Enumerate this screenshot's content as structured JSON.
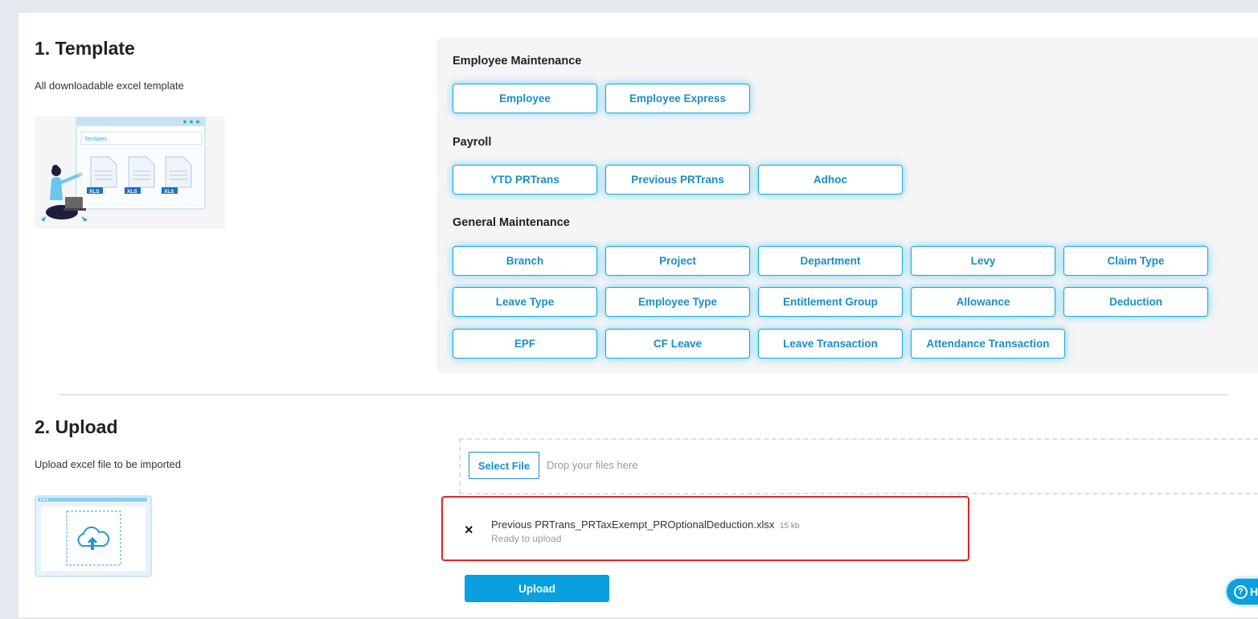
{
  "template_section": {
    "title": "1. Template",
    "description": "All downloadable excel template",
    "illustration": {
      "window_label": "Temlates",
      "file_badges": [
        "XLS",
        "XLS",
        "XLS"
      ]
    },
    "groups": {
      "employee": {
        "title": "Employee Maintenance",
        "buttons": [
          "Employee",
          "Employee Express"
        ]
      },
      "payroll": {
        "title": "Payroll",
        "buttons": [
          "YTD PRTrans",
          "Previous PRTrans",
          "Adhoc"
        ]
      },
      "general": {
        "title": "General Maintenance",
        "buttons": [
          "Branch",
          "Project",
          "Department",
          "Levy",
          "Claim Type",
          "Leave Type",
          "Employee Type",
          "Entitlement Group",
          "Allowance",
          "Deduction",
          "EPF",
          "CF Leave",
          "Leave Transaction",
          "Attendance Transaction"
        ]
      }
    }
  },
  "upload_section": {
    "title": "2. Upload",
    "description": "Upload excel file to be imported",
    "select_button": "Select File",
    "drop_text": "Drop your files here",
    "file": {
      "name": "Previous PRTrans_PRTaxExempt_PROptionalDeduction.xlsx",
      "size": "15 kb",
      "status": "Ready to upload",
      "close_icon": "×"
    },
    "upload_button": "Upload"
  },
  "help": {
    "label": "H",
    "icon": "?"
  },
  "colors": {
    "accent": "#1a8ec8",
    "button_glow": "#00beff",
    "upload_button": "#0aa0e0",
    "highlight_border": "#e02525"
  }
}
